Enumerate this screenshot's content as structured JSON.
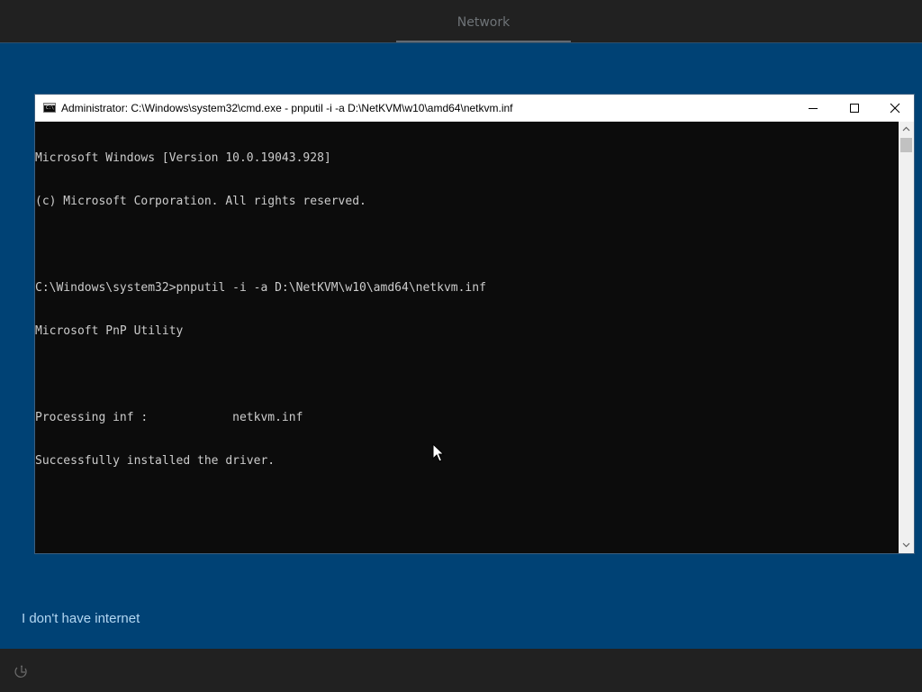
{
  "header": {
    "tab_label": "Network"
  },
  "cmd_window": {
    "title": "Administrator: C:\\Windows\\system32\\cmd.exe - pnputil  -i -a D:\\NetKVM\\w10\\amd64\\netkvm.inf",
    "icon": "command-prompt-icon",
    "icon_text": "C:\\",
    "console_lines": [
      "Microsoft Windows [Version 10.0.19043.928]",
      "(c) Microsoft Corporation. All rights reserved.",
      "",
      "C:\\Windows\\system32>pnputil -i -a D:\\NetKVM\\w10\\amd64\\netkvm.inf",
      "Microsoft PnP Utility",
      "",
      "Processing inf :            netkvm.inf",
      "Successfully installed the driver."
    ],
    "colors": {
      "console_background": "#0c0c0c",
      "console_text": "#cccccc",
      "titlebar": "#ffffff"
    }
  },
  "links": {
    "no_internet": "I don't have internet"
  },
  "colors": {
    "page_background": "#004275",
    "bars": "#212121",
    "link": "#b3d7f2"
  },
  "icons": {
    "accessibility": "ease-of-access-icon",
    "pointer": "mouse-cursor-icon"
  }
}
